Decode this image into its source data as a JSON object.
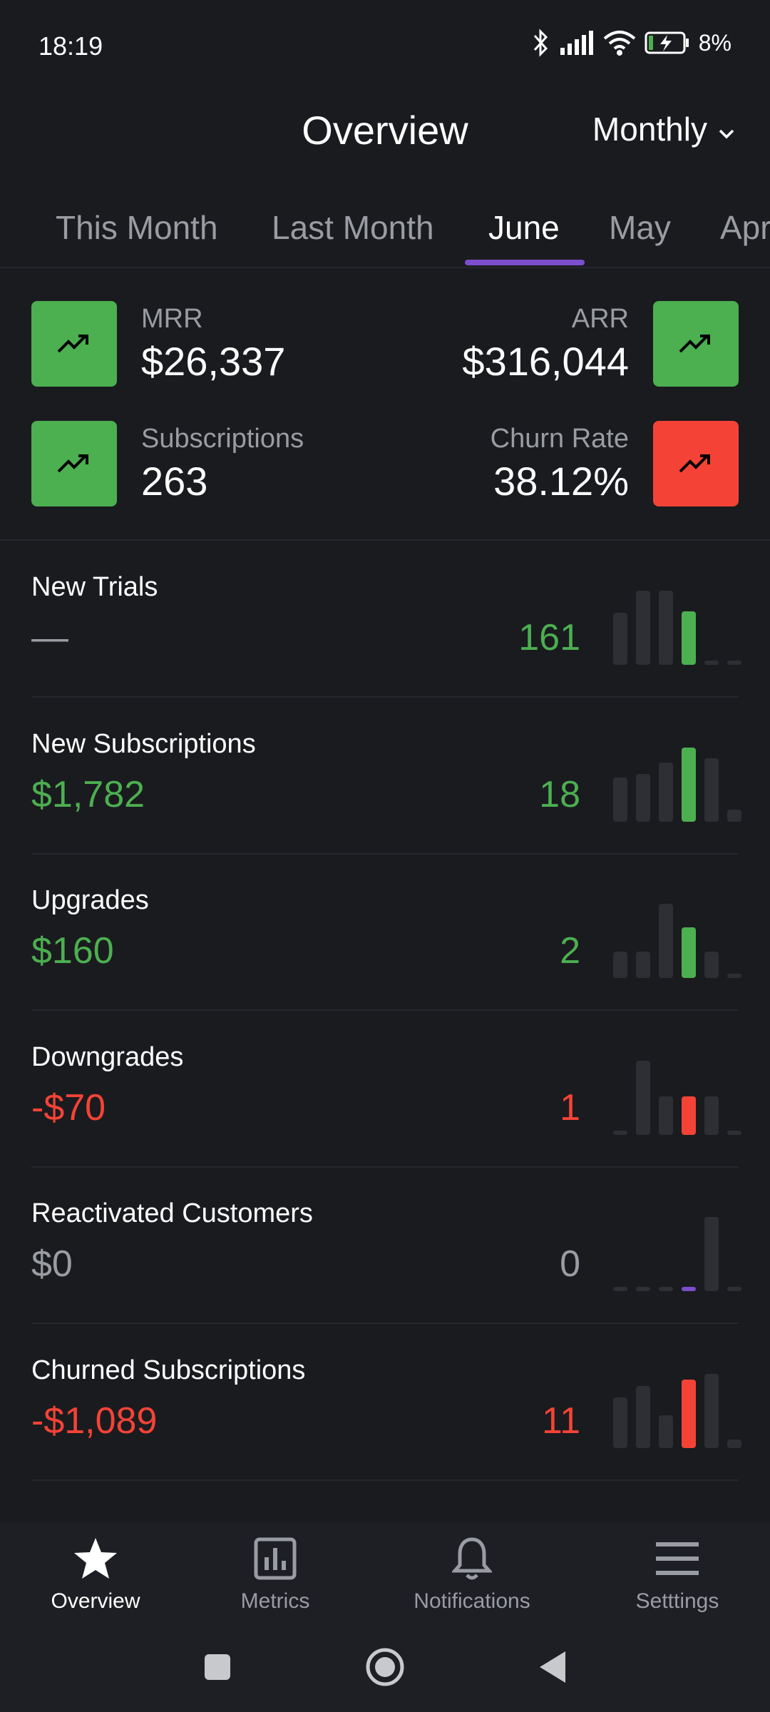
{
  "status_bar": {
    "time": "18:19",
    "battery": "8%"
  },
  "header": {
    "title": "Overview",
    "period": "Monthly"
  },
  "tabs": [
    {
      "label": "This Month",
      "active": false
    },
    {
      "label": "Last Month",
      "active": false
    },
    {
      "label": "June",
      "active": true
    },
    {
      "label": "May",
      "active": false
    },
    {
      "label": "Apr",
      "active": false
    }
  ],
  "kpis": {
    "mrr": {
      "label": "MRR",
      "value": "$26,337",
      "trend": "up",
      "color": "#4caf50"
    },
    "arr": {
      "label": "ARR",
      "value": "$316,044",
      "trend": "up",
      "color": "#4caf50"
    },
    "subscriptions": {
      "label": "Subscriptions",
      "value": "263",
      "trend": "up",
      "color": "#4caf50"
    },
    "churn": {
      "label": "Churn Rate",
      "value": "38.12%",
      "trend": "up",
      "color": "#f44336"
    }
  },
  "metrics": [
    {
      "name": "New Trials",
      "amount": "—",
      "count": "161",
      "tone": "green",
      "amount_tone": "gray",
      "bars": [
        0.7,
        1.0,
        1.0,
        0.72,
        0.04,
        0.04
      ],
      "highlight": 3
    },
    {
      "name": "New Subscriptions",
      "amount": "$1,782",
      "count": "18",
      "tone": "green",
      "amount_tone": "green",
      "bars": [
        0.6,
        0.64,
        0.8,
        1.0,
        0.86,
        0.16
      ],
      "highlight": 3
    },
    {
      "name": "Upgrades",
      "amount": "$160",
      "count": "2",
      "tone": "green",
      "amount_tone": "green",
      "bars": [
        0.36,
        0.36,
        1.0,
        0.68,
        0.36,
        0.04
      ],
      "highlight": 3
    },
    {
      "name": "Downgrades",
      "amount": "-$70",
      "count": "1",
      "tone": "red",
      "amount_tone": "red",
      "bars": [
        0.04,
        1.0,
        0.52,
        0.52,
        0.52,
        0.04
      ],
      "highlight": 3
    },
    {
      "name": "Reactivated Customers",
      "amount": "$0",
      "count": "0",
      "tone": "gray",
      "amount_tone": "gray",
      "bars": [
        0.04,
        0.04,
        0.04,
        0.04,
        1.0,
        0.04
      ],
      "highlight": 3
    },
    {
      "name": "Churned Subscriptions",
      "amount": "-$1,089",
      "count": "11",
      "tone": "red",
      "amount_tone": "red",
      "bars": [
        0.68,
        0.84,
        0.44,
        0.92,
        1.0,
        0.12
      ],
      "highlight": 3
    }
  ],
  "colors": {
    "green": "#4caf50",
    "red": "#f44336",
    "purple": "#7c4dcc",
    "bar_dim": "#2e2f34",
    "bg": "#1a1b1f"
  },
  "bottom_nav": [
    {
      "label": "Overview",
      "icon": "star-icon",
      "active": true
    },
    {
      "label": "Metrics",
      "icon": "bar-chart-icon",
      "active": false
    },
    {
      "label": "Notifications",
      "icon": "bell-icon",
      "active": false
    },
    {
      "label": "Setttings",
      "icon": "menu-icon",
      "active": false
    }
  ]
}
